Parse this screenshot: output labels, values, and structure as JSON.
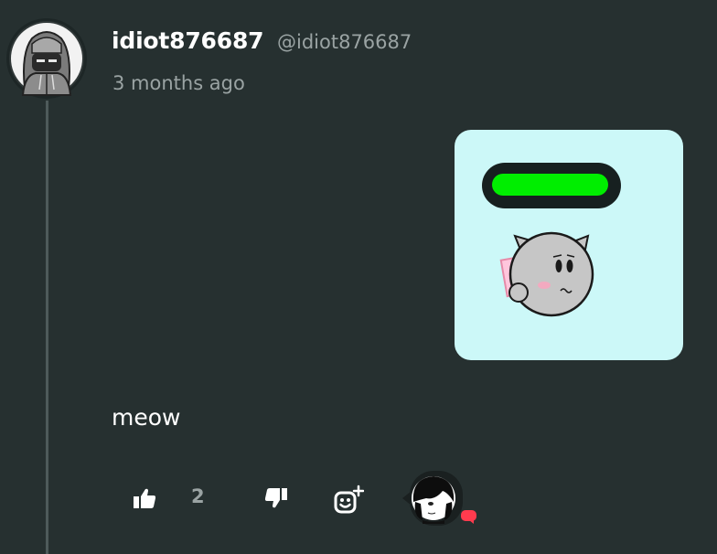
{
  "comment": {
    "username": "idiot876687",
    "handle": "@idiot876687",
    "timestamp": "3 months ago",
    "text": "meow",
    "sticker": {
      "description_icon": "cat-sticker-icon",
      "health_bar_level": 1.0,
      "health_bar_color": "#00ee00",
      "background": "#ccf8f8"
    }
  },
  "actions": {
    "like_count": "2",
    "like_icon": "thumbs-up-icon",
    "dislike_icon": "thumbs-down-icon",
    "react_icon": "add-reaction-icon"
  },
  "colors": {
    "background": "#263030",
    "text_primary": "#ffffff",
    "text_secondary": "#9aa3a3",
    "badge": "#ff3b4e"
  }
}
